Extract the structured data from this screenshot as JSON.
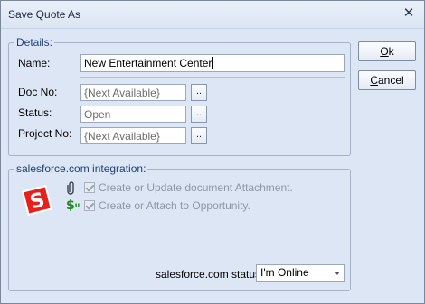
{
  "window": {
    "title": "Save Quote As",
    "close_glyph": "✕"
  },
  "details": {
    "legend": "Details:",
    "name_label": "Name:",
    "name_value": "New Entertainment Center",
    "docno_label": "Doc No:",
    "docno_value": "{Next Available}",
    "status_label": "Status:",
    "status_value": "Open",
    "projectno_label": "Project No:",
    "projectno_value": "{Next Available}",
    "ellipsis_label": ".."
  },
  "buttons": {
    "ok_label": "Ok",
    "cancel_label": "Cancel"
  },
  "salesforce": {
    "legend": "salesforce.com integration:",
    "logo_letter": "S",
    "logo_color": "#e8201b",
    "dollar_icon_text": "$",
    "dollar_color": "#1d8a1d",
    "option1_label": "Create or Update document Attachment.",
    "option2_label": "Create or Attach to Opportunity.",
    "status_label": "salesforce.com status:",
    "status_value": "I'm Online"
  }
}
